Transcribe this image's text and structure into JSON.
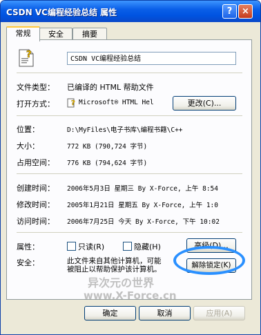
{
  "window": {
    "title": "CSDN VC编程经验总结 属性",
    "help_glyph": "?",
    "close_glyph": "×"
  },
  "tabs": [
    {
      "label": "常规"
    },
    {
      "label": "安全"
    },
    {
      "label": "摘要"
    }
  ],
  "file": {
    "name": "CSDN VC编程经验总结",
    "icon": "help-file-icon"
  },
  "props": {
    "type_label": "文件类型：",
    "type_value": "已编译的 HTML 帮助文件",
    "open_label": "打开方式：",
    "open_value": "Microsoft® HTML Hel",
    "change_button": "更改(C)...",
    "location_label": "位置：",
    "location_value": "D:\\MyFiles\\电子书库\\编程书籍\\C++",
    "size_label": "大小：",
    "size_value": "772 KB (790,724 字节)",
    "disk_label": "占用空间：",
    "disk_value": "776 KB (794,624 字节)",
    "created_label": "创建时间：",
    "created_value": "2006年5月3日 星期三 By X-Force, 上午 8:54",
    "modified_label": "修改时间：",
    "modified_value": "2005年1月21日 星期五 By X-Force, 上午 1:0",
    "accessed_label": "访问时间：",
    "accessed_value": "2006年7月25日 今天 By X-Force, 下午 10:02",
    "attr_label": "属性：",
    "readonly_label": "只读(R)",
    "hidden_label": "隐藏(H)",
    "advanced_button": "高级(D)...",
    "security_label": "安全：",
    "security_text_1": "此文件来自其他计算机，可能",
    "security_text_2": "被阻止以帮助保护该计算机。",
    "unblock_button": "解除锁定(K)"
  },
  "watermark": {
    "line1": "异次元の世界",
    "line2": "www.X-Force.cn"
  },
  "footer": {
    "ok": "确定",
    "cancel": "取消",
    "apply": "应用(A)"
  }
}
